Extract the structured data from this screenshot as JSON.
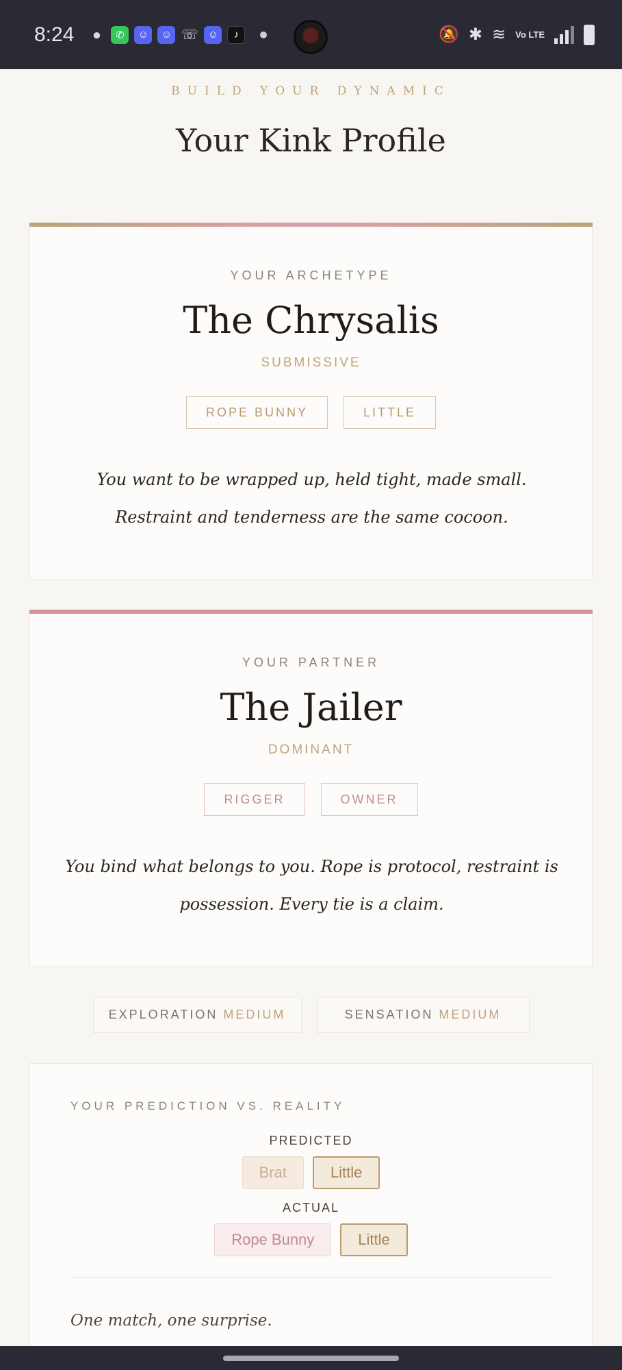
{
  "status_bar": {
    "time": "8:24",
    "notification_icons": [
      "chat-bubble-icon",
      "whatsapp-icon",
      "discord-icon",
      "discord-icon",
      "missed-call-icon",
      "discord-icon",
      "tiktok-icon",
      "more-dot-icon"
    ],
    "system_icons": [
      "mute-icon",
      "bluetooth-icon",
      "wifi-icon",
      "volte-icon",
      "signal-icon",
      "battery-icon"
    ],
    "volte_text": "Vo LTE"
  },
  "header": {
    "eyebrow": "BUILD YOUR DYNAMIC",
    "title": "Your Kink Profile"
  },
  "archetype_card": {
    "label": "YOUR ARCHETYPE",
    "name": "The Chrysalis",
    "role": "SUBMISSIVE",
    "tags": [
      "ROPE BUNNY",
      "LITTLE"
    ],
    "description": "You want to be wrapped up, held tight, made small. Restraint and tenderness are the same cocoon.",
    "accent_gradient": [
      "#c0a27a",
      "#d6a3ad",
      "#c0a27a"
    ]
  },
  "partner_card": {
    "label": "YOUR PARTNER",
    "name": "The Jailer",
    "role": "DOMINANT",
    "tags": [
      "RIGGER",
      "OWNER"
    ],
    "description": "You bind what belongs to you. Rope is protocol, restraint is possession. Every tie is a claim.",
    "accent_color": "#cf939c"
  },
  "meters": [
    {
      "label": "EXPLORATION",
      "level": "MEDIUM"
    },
    {
      "label": "SENSATION",
      "level": "MEDIUM"
    }
  ],
  "prediction": {
    "title": "YOUR PREDICTION VS. REALITY",
    "predicted_label": "PREDICTED",
    "predicted": [
      "Brat",
      "Little"
    ],
    "actual_label": "ACTUAL",
    "actual": [
      "Rope Bunny",
      "Little"
    ],
    "summary": "One match, one surprise."
  },
  "colors": {
    "gold": "#c0a27a",
    "rose": "#c48894",
    "background": "#f8f6f3",
    "status_bar": "#2a2a34"
  }
}
